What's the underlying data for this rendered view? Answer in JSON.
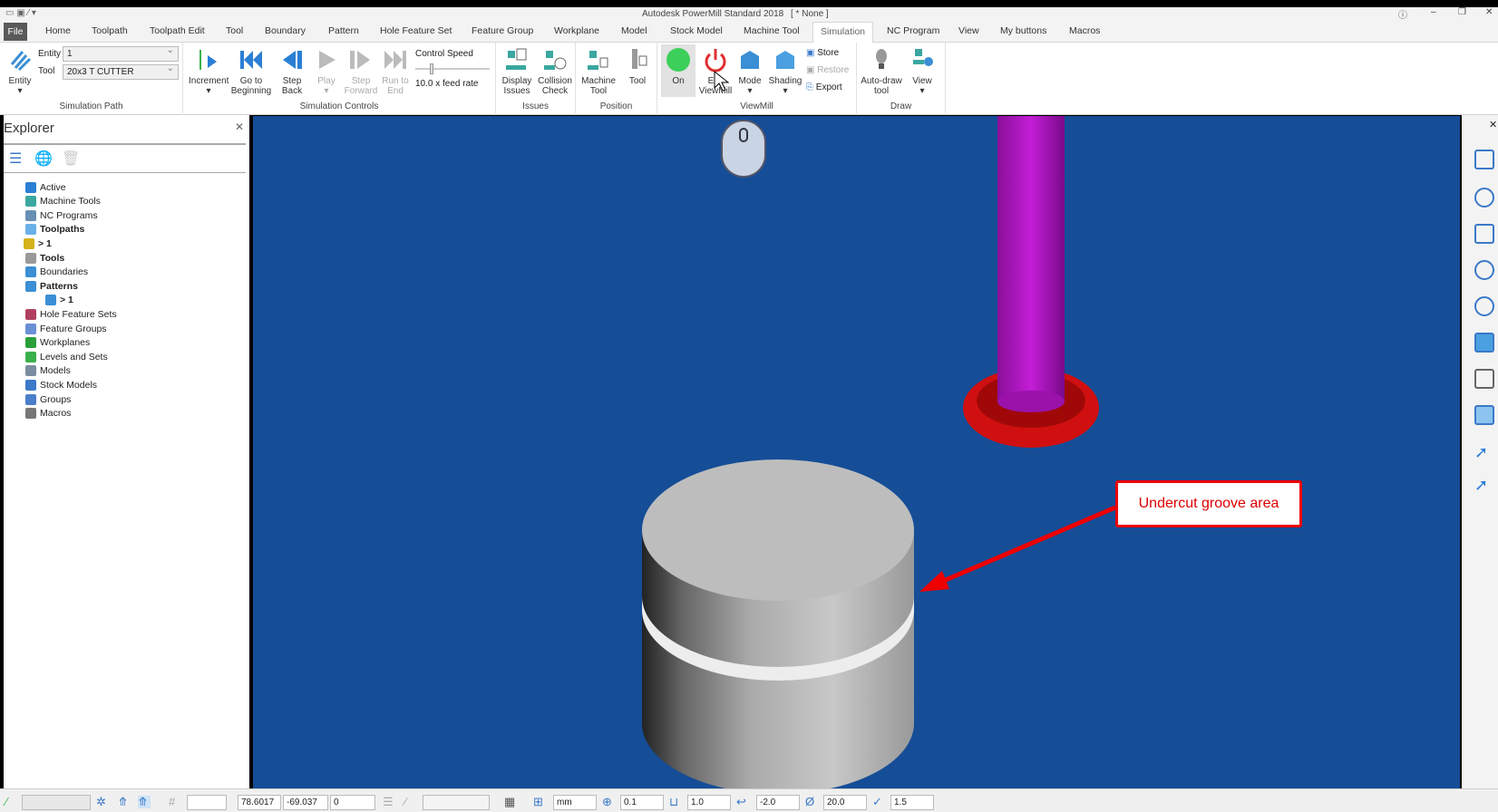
{
  "window": {
    "title": "Autodesk PowerMill Standard 2018",
    "project": "[ * None ]"
  },
  "tabs": [
    "File",
    "Home",
    "Toolpath",
    "Toolpath Edit",
    "Tool",
    "Boundary",
    "Pattern",
    "Hole Feature Set",
    "Feature Group",
    "Workplane",
    "Model",
    "Stock Model",
    "Machine Tool",
    "Simulation",
    "NC Program",
    "View",
    "My buttons",
    "Macros"
  ],
  "active_tab": "Simulation",
  "ribbon": {
    "simulation_path": {
      "label": "Simulation Path",
      "entity_btn": "Entity",
      "entity_label": "Entity",
      "entity_value": "1",
      "tool_label": "Tool",
      "tool_value": "20x3 T CUTTER"
    },
    "simulation_controls": {
      "label": "Simulation Controls",
      "increment": "Increment",
      "go_begin": "Go to Beginning",
      "step_back": "Step Back",
      "play": "Play",
      "step_forward": "Step Forward",
      "run_end": "Run to End",
      "control_speed": "Control Speed",
      "feed_rate": "10.0 x feed rate"
    },
    "issues": {
      "label": "Issues",
      "display": "Display Issues",
      "collision": "Collision Check"
    },
    "position": {
      "label": "Position",
      "machine_tool": "Machine Tool",
      "tool": "Tool"
    },
    "viewmill": {
      "label": "ViewMill",
      "on": "On",
      "exit": "Exit ViewMill",
      "mode": "Mode",
      "shading": "Shading",
      "store": "Store",
      "restore": "Restore",
      "export": "Export"
    },
    "draw": {
      "label": "Draw",
      "autodraw": "Auto-draw tool",
      "view": "View"
    }
  },
  "explorer": {
    "title": "Explorer",
    "items": [
      {
        "label": "Active",
        "bold": false,
        "color": "#2a7fd4"
      },
      {
        "label": "Machine Tools",
        "bold": false,
        "color": "#3aa7a0"
      },
      {
        "label": "NC Programs",
        "bold": false,
        "color": "#6a8fb5"
      },
      {
        "label": "Toolpaths",
        "bold": true,
        "color": "#6ab0e8"
      },
      {
        "label": "> 1",
        "bold": true,
        "color": "#d4b21a",
        "child": true
      },
      {
        "label": "Tools",
        "bold": true,
        "color": "#999"
      },
      {
        "label": "Boundaries",
        "bold": false,
        "color": "#3b8fd4"
      },
      {
        "label": "Patterns",
        "bold": true,
        "color": "#3b8fd4"
      },
      {
        "label": "> 1",
        "bold": true,
        "color": "#3b8fd4",
        "child": true
      },
      {
        "label": "Hole Feature Sets",
        "bold": false,
        "color": "#b04060"
      },
      {
        "label": "Feature Groups",
        "bold": false,
        "color": "#6a8fd4"
      },
      {
        "label": "Workplanes",
        "bold": false,
        "color": "#2a9f3a"
      },
      {
        "label": "Levels and Sets",
        "bold": false,
        "color": "#3cb04a"
      },
      {
        "label": "Models",
        "bold": false,
        "color": "#7a8ca0"
      },
      {
        "label": "Stock Models",
        "bold": false,
        "color": "#3b79c9"
      },
      {
        "label": "Groups",
        "bold": false,
        "color": "#4a7fc9"
      },
      {
        "label": "Macros",
        "bold": false,
        "color": "#777"
      }
    ]
  },
  "annotation": {
    "text": "Undercut groove area"
  },
  "status": {
    "x": "78.6017",
    "y": "-69.037",
    "z": "0",
    "units": "mm",
    "tolerance": "0.1",
    "stepover": "1.0",
    "offset": "-2.0",
    "diameter": "20.0",
    "angle": "1.5"
  },
  "colors": {
    "viewport": "#154d97",
    "accent": "#3b79c9",
    "annotation": "#e00000"
  }
}
